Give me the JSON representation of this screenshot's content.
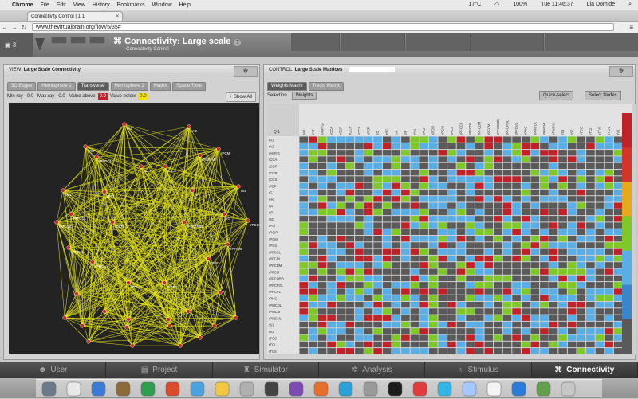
{
  "menubar": {
    "app": "Chrome",
    "items": [
      "File",
      "Edit",
      "View",
      "History",
      "Bookmarks",
      "Window",
      "Help"
    ],
    "temp": "17°C",
    "battery": "100%",
    "clock": "Tue 11:46:37",
    "user": "Lia Domide"
  },
  "browser": {
    "tab_title": "Connectivity Control | 1.1",
    "url": "www.thevirtualbrain.org/flow/5/35#"
  },
  "header": {
    "project_num": "3",
    "title": "Connectivity: Large scale",
    "subtitle": "Connectivity Control"
  },
  "view_panel": {
    "label": "VIEW:",
    "title": "Large Scale Connectivity",
    "tabs": [
      "3D Edges",
      "Hemisphere 1",
      "Transverse",
      "Hemisphere 2",
      "Matrix",
      "Space Time"
    ],
    "active_tab": 2,
    "min_ray_label": "Min ray",
    "min_ray": "0.0",
    "max_ray_label": "Max ray",
    "max_ray": "0.0",
    "value_above_label": "Value above",
    "value_above": "0.0",
    "value_below_label": "Value below",
    "value_below": "0.0",
    "show_all": "Show All"
  },
  "control_panel": {
    "label": "CONTROL:",
    "title": "Large Scale Matrices",
    "tabs": [
      "Weights Matrix",
      "Tracts Matrix"
    ],
    "active_tab": 0,
    "selection_label": "Selection",
    "weights_btn": "Weights",
    "quick_select": "Quick-select",
    "select_nodes": "Select Nodes",
    "corner_label": "Q 1",
    "rows": [
      "rA1",
      "rA2",
      "rAMYG",
      "rCCA",
      "rCCP",
      "rCCR",
      "rCCS",
      "rFEF",
      "rG",
      "rHC",
      "rIA",
      "rIP",
      "rM1",
      "rPCI",
      "rPCIP",
      "rPCM",
      "rPCS",
      "rPFCCL",
      "rPFCDL",
      "rPFCDM",
      "rPFCM",
      "rPFCORB",
      "rPFCPOL",
      "rPFCVL",
      "rPHC",
      "rPMCDL",
      "rPMCM",
      "rPMCVL",
      "rS1",
      "rS2",
      "rTCC",
      "rTCI",
      "rTCS"
    ],
    "cols": [
      "rA1",
      "rA2",
      "rAMYG",
      "rCCA",
      "rCCP",
      "rCCR",
      "rCCS",
      "rFEF",
      "rG",
      "rHC",
      "rIA",
      "rIP",
      "rM1",
      "rPCI",
      "rPCIP",
      "rPCM",
      "rPCS",
      "rPFCCL",
      "rPFCDL",
      "rPFCDM",
      "rPFCM",
      "rPFCORB",
      "rPFCPOL",
      "rPFCVL",
      "rPHC",
      "rPMCDL",
      "rPMCM",
      "rPMCVL",
      "rS1",
      "rS2",
      "rTCC",
      "rTCI",
      "rTCS",
      "rTCV",
      "rV1",
      "rV2"
    ]
  },
  "brain_nodes": [
    "rA1",
    "rA2",
    "rFEF",
    "rPCM",
    "rPFCDM",
    "rPMCM",
    "rCCP",
    "rCCS",
    "rM1",
    "rS1",
    "rPCI",
    "rIA",
    "rPFCCL",
    "rG",
    "rPFCDL",
    "rTCC",
    "rCCR",
    "rPFCORB",
    "rPFCVL",
    "rPFCM",
    "rPMCVL",
    "rPHC",
    "rTCV",
    "rPCIP"
  ],
  "nav": {
    "items": [
      "User",
      "Project",
      "Simulator",
      "Analysis",
      "Stimulus",
      "Connectivity"
    ],
    "active": 5
  },
  "colors": {
    "connection": "#e3e31a",
    "node": "#c92a2a",
    "cell_gray": "#5a5a5a",
    "cell_blue": "#5aaee6",
    "cell_green": "#7ec829",
    "cell_red": "#c0222a",
    "legend": [
      "#c0222a",
      "#d3352a",
      "#e8a81e",
      "#7ec829",
      "#5aaee6",
      "#3a86c8",
      "#5a5a5a"
    ]
  }
}
